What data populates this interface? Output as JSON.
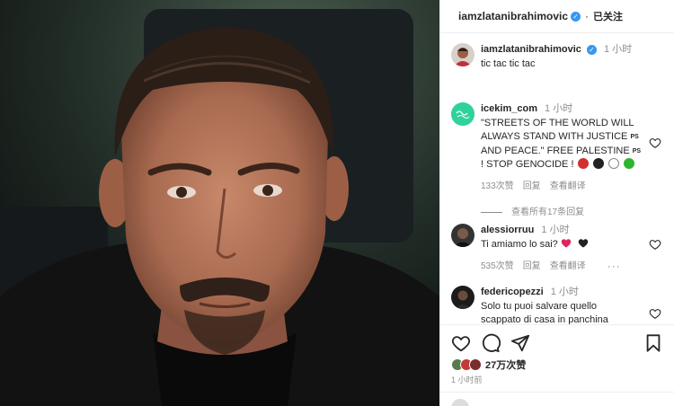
{
  "post": {
    "username": "iamzlatanibrahimovic",
    "follow_state": "已关注",
    "caption_time": "1 小时",
    "caption": "tic tac tic tac",
    "likes": "27万次赞",
    "time_ago": "1 小时前"
  },
  "comments": [
    {
      "username": "icekim_com",
      "time": "1 小时",
      "text_lines": [
        "\"STREETS OF THE WORLD WILL",
        "ALWAYS STAND WITH JUSTICE",
        "AND PEACE.\" FREE PALESTINE",
        "! STOP GENOCIDE !"
      ],
      "ps_label": "PS",
      "likes": "133次赞",
      "reply": "回复",
      "translate": "查看翻译",
      "view_replies": "查看所有17条回复"
    },
    {
      "username": "alessiorruu",
      "time": "1 小时",
      "text": "Ti amiamo lo sai?",
      "likes": "535次赞",
      "reply": "回复",
      "translate": "查看翻译",
      "more": "···"
    },
    {
      "username": "federicopezzi",
      "time": "1 小时",
      "text_lines": [
        "Solo tu puoi salvare quello",
        "scappato di casa in panchina"
      ]
    }
  ],
  "colors": {
    "verified": "#3897f0",
    "heart_red": "#ed4956",
    "meta_gray": "#8e8e8e",
    "avatar_green": "#2fd39a"
  },
  "icons": [
    "verified-badge-icon",
    "heart-icon",
    "comment-icon",
    "share-icon",
    "bookmark-icon"
  ]
}
